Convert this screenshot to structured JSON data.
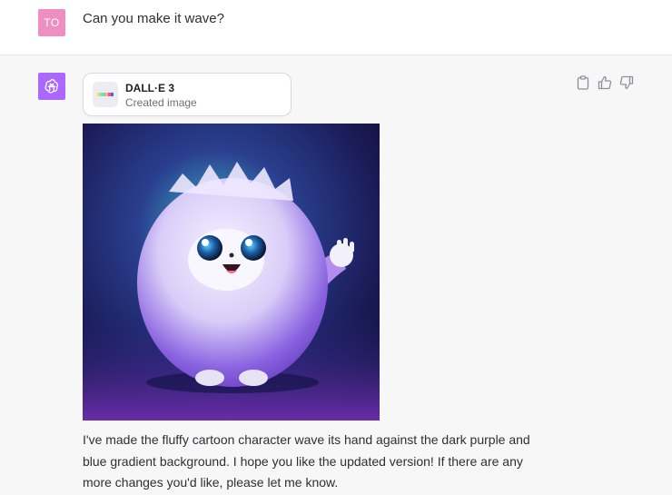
{
  "user": {
    "avatar_initials": "TO",
    "message": "Can you make it wave?"
  },
  "assistant": {
    "tool": {
      "title": "DALL·E 3",
      "subtitle": "Created image"
    },
    "actions": [
      {
        "icon": "clipboard-icon"
      },
      {
        "icon": "thumbs-up-icon"
      },
      {
        "icon": "thumbs-down-icon"
      }
    ],
    "response": "I've made the fluffy cartoon character wave its hand against the dark purple and blue gradient background. I hope you like the updated version! If there are any more changes you'd like, please let me know."
  },
  "colors": {
    "user_avatar_bg": "#ee8fc2",
    "assistant_avatar_bg": "#ab68ff",
    "page_bg": "#f7f7f8"
  }
}
